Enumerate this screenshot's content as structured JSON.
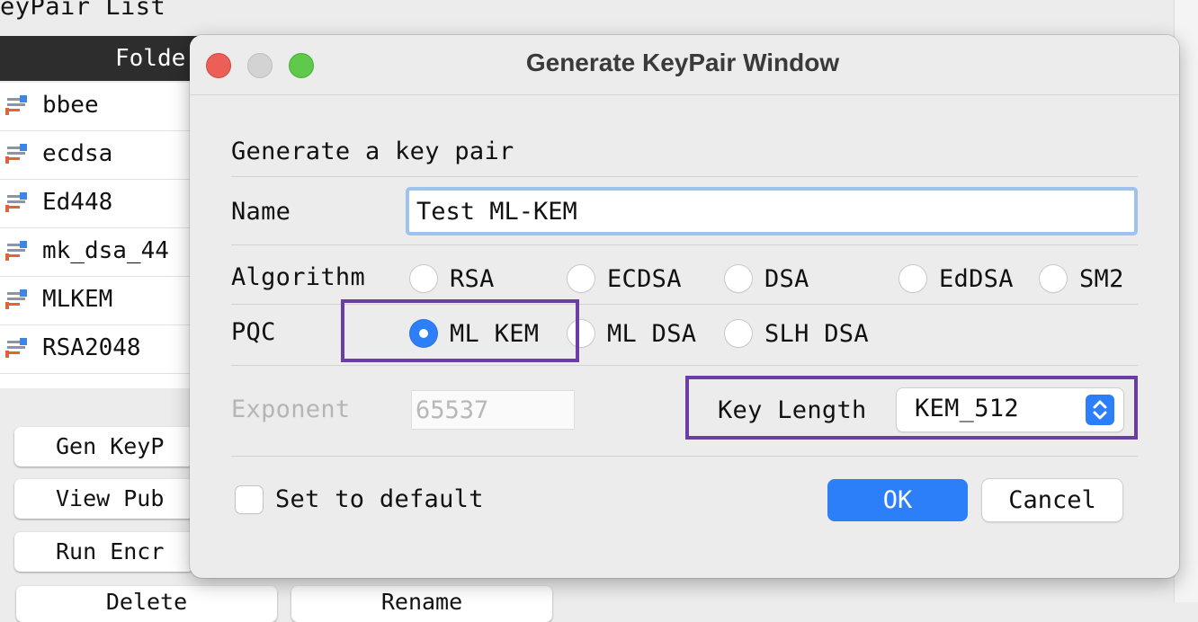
{
  "background_window": {
    "title": "eyPair List",
    "header": "Folde",
    "list_items": [
      {
        "label": "bbee",
        "icon": "keypair-file-icon"
      },
      {
        "label": "ecdsa",
        "icon": "keypair-file-icon"
      },
      {
        "label": "Ed448",
        "icon": "keypair-file-icon"
      },
      {
        "label": "mk_dsa_44",
        "icon": "keypair-file-icon"
      },
      {
        "label": "MLKEM",
        "icon": "keypair-file-icon"
      },
      {
        "label": "RSA2048",
        "icon": "keypair-file-icon"
      }
    ],
    "buttons": {
      "gen": "Gen KeyP",
      "view": "View Pub",
      "run": "Run Encr",
      "delete": "Delete",
      "rename": "Rename"
    }
  },
  "dialog": {
    "title": "Generate KeyPair Window",
    "heading": "Generate a key pair",
    "name_label": "Name",
    "name_value": "Test ML-KEM",
    "algorithm_label": "Algorithm",
    "algorithms": [
      "RSA",
      "ECDSA",
      "DSA",
      "EdDSA",
      "SM2"
    ],
    "pqc_label": "PQC",
    "pqc_options": [
      "ML KEM",
      "ML DSA",
      "SLH DSA"
    ],
    "pqc_selected": "ML KEM",
    "exponent_label": "Exponent",
    "exponent_value": "65537",
    "key_length_label": "Key Length",
    "key_length_value": "KEM_512",
    "set_default_label": "Set to default",
    "ok_label": "OK",
    "cancel_label": "Cancel"
  },
  "colors": {
    "accent": "#2d7ff9",
    "highlight": "#6b3ea6",
    "close": "#ec5f57",
    "zoom": "#5ec94b"
  }
}
